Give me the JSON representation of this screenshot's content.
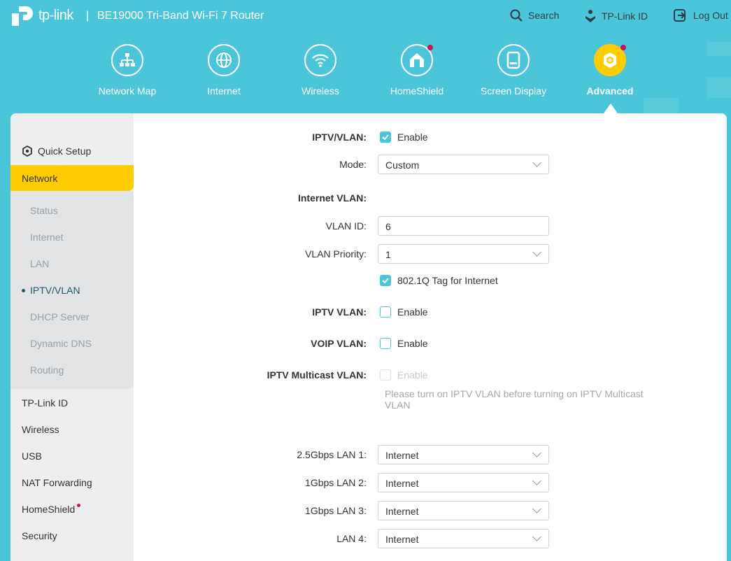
{
  "header": {
    "brand": "tp-link",
    "model": "BE19000 Tri-Band Wi-Fi 7 Router",
    "search": "Search",
    "tplink_id": "TP-Link ID",
    "logout": "Log Out"
  },
  "nav": [
    {
      "label": "Network Map",
      "icon": "network-map-icon"
    },
    {
      "label": "Internet",
      "icon": "globe-icon"
    },
    {
      "label": "Wireless",
      "icon": "wifi-icon"
    },
    {
      "label": "HomeShield",
      "icon": "homeshield-icon",
      "badge": true
    },
    {
      "label": "Screen Display",
      "icon": "screen-icon"
    },
    {
      "label": "Advanced",
      "icon": "gear-icon",
      "active": true,
      "badge": true
    }
  ],
  "sidebar": {
    "quick_setup": "Quick Setup",
    "network": "Network",
    "network_sub": [
      "Status",
      "Internet",
      "LAN",
      "IPTV/VLAN",
      "DHCP Server",
      "Dynamic DNS",
      "Routing"
    ],
    "active_sub": "IPTV/VLAN",
    "items": [
      "TP-Link ID",
      "Wireless",
      "USB",
      "NAT Forwarding",
      "HomeShield",
      "Security"
    ]
  },
  "form": {
    "iptv_vlan_label": "IPTV/VLAN",
    "enable": "Enable",
    "mode_label": "Mode",
    "mode_value": "Custom",
    "internet_vlan_label": "Internet VLAN",
    "vlan_id_label": "VLAN ID",
    "vlan_id_value": "6",
    "vlan_priority_label": "VLAN Priority",
    "vlan_priority_value": "1",
    "tag_label": "802.1Q Tag for Internet",
    "iptv_label": "IPTV VLAN",
    "voip_label": "VOIP VLAN",
    "multicast_label": "IPTV Multicast VLAN",
    "help": "Please turn on IPTV VLAN before turning on IPTV Multicast VLAN",
    "ports": [
      {
        "label": "2.5Gbps LAN 1",
        "value": "Internet"
      },
      {
        "label": "1Gbps LAN 2",
        "value": "Internet"
      },
      {
        "label": "1Gbps LAN 3",
        "value": "Internet"
      },
      {
        "label": "LAN 4",
        "value": "Internet"
      }
    ]
  },
  "colors": {
    "header": "#4bc5d9",
    "accent": "#ffcc00",
    "badge": "#c2185b"
  }
}
